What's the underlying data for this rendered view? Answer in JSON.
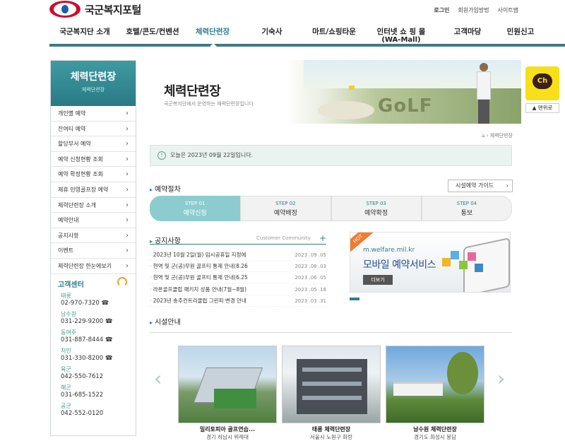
{
  "header": {
    "site_name": "국군복지포털",
    "util": [
      "로그인",
      "회원가입방법",
      "사이트맵"
    ]
  },
  "gnb": {
    "items": [
      {
        "label": "국군복지단 소개"
      },
      {
        "label": "호텔/콘도/컨벤션"
      },
      {
        "label": "체력단련장"
      },
      {
        "label": "기숙사"
      },
      {
        "label": "마트/쇼핑타운"
      },
      {
        "label": "인터넷 쇼 핑 몰",
        "sub": "(WA-Mall)"
      },
      {
        "label": "고객마당"
      },
      {
        "label": "민원신고"
      }
    ]
  },
  "lnb": {
    "title": "체력단련장",
    "subtitle": "체력단련장",
    "items": [
      "개인별 예약",
      "잔여티 예약",
      "할당부서 예약",
      "예약 신청현황 조회",
      "예약 확정현황 조회",
      "제휴 민영골프장 예약",
      "체력단련장 소개",
      "예약안내",
      "공지사항",
      "이벤트",
      "체력단련장 한눈에보기"
    ]
  },
  "customer_center": {
    "title": "고객센터",
    "entries": [
      {
        "name": "태릉",
        "phone": "02-970-7320 ☎"
      },
      {
        "name": "남수원",
        "phone": "031-229-9200 ☎"
      },
      {
        "name": "동여주",
        "phone": "031-887-8444 ☎"
      },
      {
        "name": "처인",
        "phone": "031-330-8200 ☎"
      },
      {
        "name": "육군",
        "phone": "042-550-7612"
      },
      {
        "name": "해군",
        "phone": "031-685-1522"
      },
      {
        "name": "공군",
        "phone": "042-552-0120"
      }
    ]
  },
  "banner": {
    "title": "체력단련장",
    "desc": "국군복지단에서 운영하는 체력단련장입니다",
    "golf_text": "GoLF"
  },
  "breadcrumb": "체력단련장",
  "today": {
    "text": "오늘은 2023년 09월 22일입니다.",
    "icon_glyph": "!"
  },
  "reservation": {
    "title": "예약절차",
    "guide_button": "시설예약 가이드",
    "steps": [
      {
        "no": "STEP 01",
        "name": "예약신청"
      },
      {
        "no": "STEP 02",
        "name": "예약배정"
      },
      {
        "no": "STEP 03",
        "name": "예약확정"
      },
      {
        "no": "STEP 04",
        "name": "통보"
      }
    ]
  },
  "notice": {
    "title": "공지사항",
    "more": "Customer Community",
    "more_icon": "+",
    "rows": [
      {
        "title": "2023년 10월 2일(월) 임시공휴일 지정에",
        "date": "2023 .09 .05"
      },
      {
        "title": "현역 및 군(공)무원 골프티 통제 안내(8.26",
        "date": "2023 .08 .03"
      },
      {
        "title": "현역 및 군(공)무원 골프티 통제 안내(6.25",
        "date": "2023 .06 .05"
      },
      {
        "title": "라온골프클럽 패키지 상품 안내(7월~8월)",
        "date": "2023 .05 .18"
      },
      {
        "title": "2023년 송추컨트리클럽 그린피 변경 안내",
        "date": "2023 .03 .31"
      }
    ]
  },
  "mobile_promo": {
    "hot": "HOT",
    "url": "m.welfare.mil.kr",
    "title": "모바일 예약서비스",
    "button": "더보기"
  },
  "facilities": {
    "title": "시설안내",
    "cards": [
      {
        "name": "밀리토피아 골프연습...",
        "addr": "경기 하남시 위례대"
      },
      {
        "name": "태릉 체력단련장",
        "addr": "서울시 노원구 화랑"
      },
      {
        "name": "남수원 체력단련장",
        "addr": "경기도 화성시 봉담"
      }
    ]
  },
  "quick": {
    "kakao": "Ch",
    "top": "맨위로"
  }
}
